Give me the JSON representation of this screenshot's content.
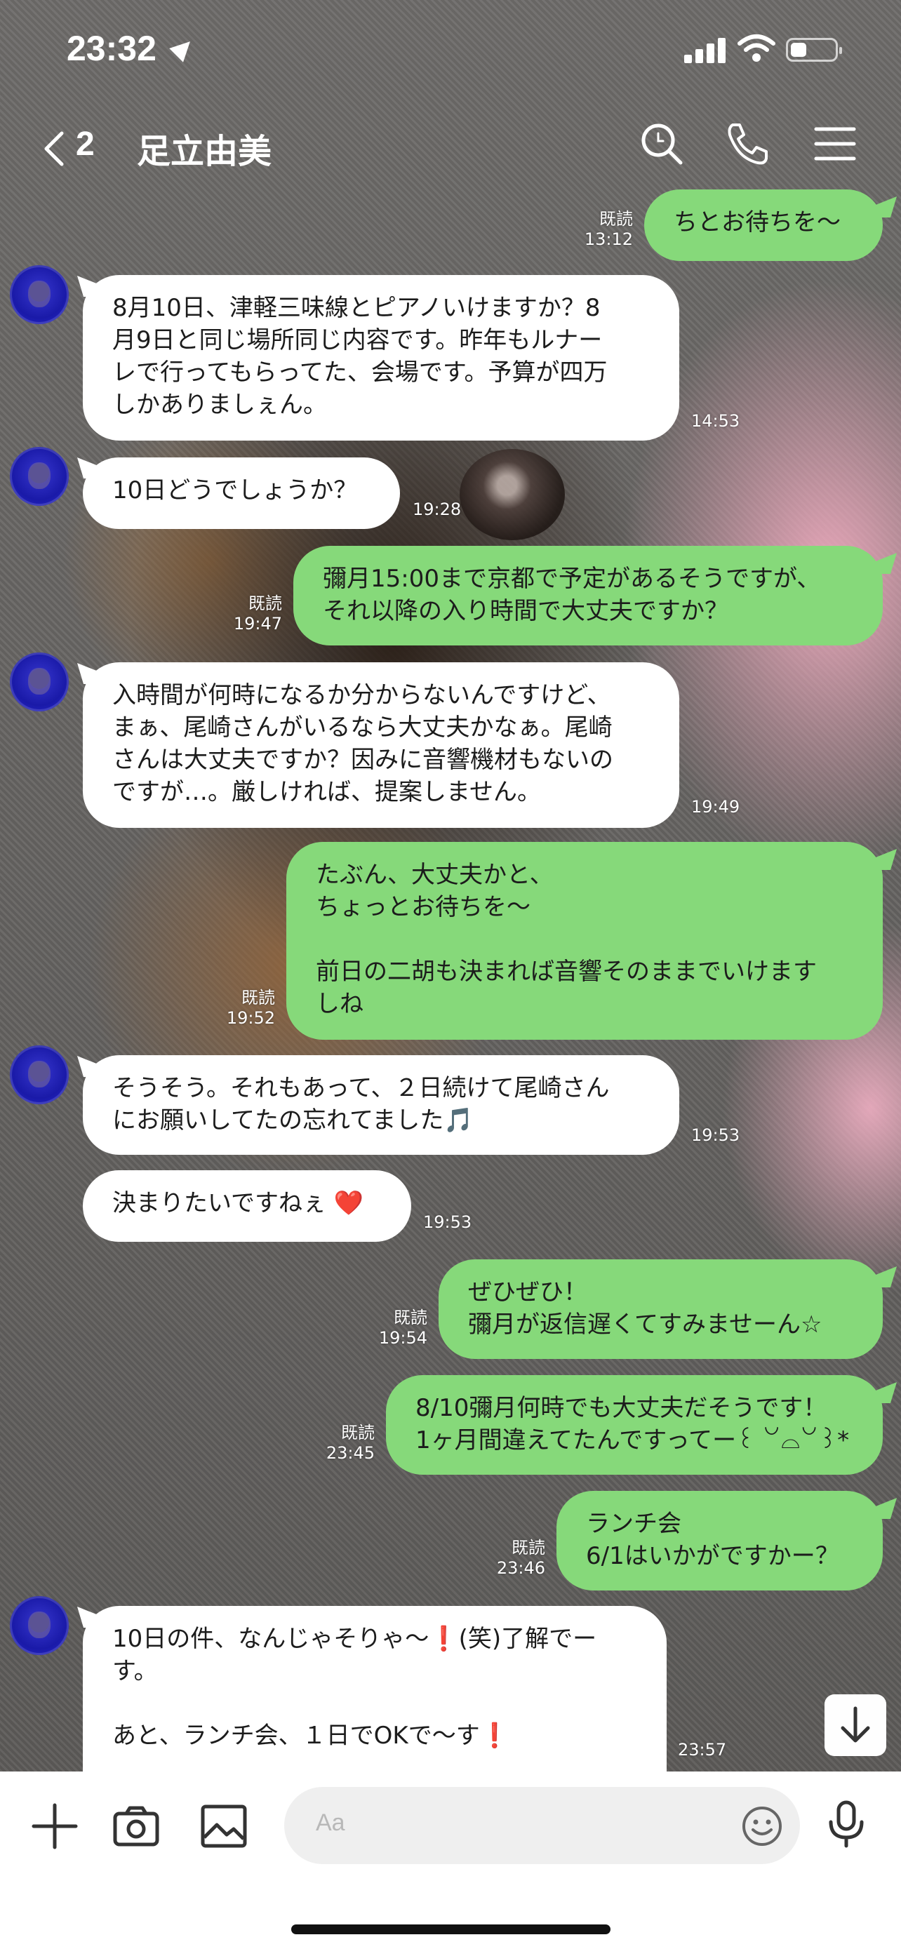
{
  "status_bar": {
    "time": "23:32"
  },
  "header": {
    "back_count": "2",
    "contact_name": "足立由美"
  },
  "messages": [
    {
      "dir": "out",
      "text": "ちとお待ちを〜",
      "read": "既読",
      "time": "13:12"
    },
    {
      "dir": "in",
      "text": "8月10日、津軽三味線とピアノいけますか？8\n月9日と同じ場所同じ内容です。昨年もルナー\nレで行ってもらってた、会場です。予算が四万\nしかありましぇん。",
      "time": "14:53"
    },
    {
      "dir": "in",
      "text": "10日どうでしょうか？",
      "time": "19:28"
    },
    {
      "dir": "out",
      "text": "彌月15:00まで京都で予定があるそうですが、\nそれ以降の入り時間で大丈夫ですか？",
      "read": "既読",
      "time": "19:47"
    },
    {
      "dir": "in",
      "text": "入時間が何時になるか分からないんですけど、\nまぁ、尾崎さんがいるなら大丈夫かなぁ。尾崎\nさんは大丈夫ですか？因みに音響機材もないの\nですが…。厳しければ、提案しません。",
      "time": "19:49"
    },
    {
      "dir": "out",
      "text": "たぶん、大丈夫かと、\nちょっとお待ちを〜\n\n前日の二胡も決まれば音響そのままでいけます\nしね",
      "read": "既読",
      "time": "19:52"
    },
    {
      "dir": "in",
      "text": "そうそう。それもあって、２日続けて尾崎さん\nにお願いしてたの忘れてました🎵",
      "time": "19:53"
    },
    {
      "dir": "in",
      "text": "決まりたいですねぇ ❤️",
      "time": "19:53"
    },
    {
      "dir": "out",
      "text": "ぜひぜひ！\n彌月が返信遅くてすみませーん☆",
      "read": "既読",
      "time": "19:54"
    },
    {
      "dir": "out",
      "text": "8/10彌月何時でも大丈夫だそうです！\n1ヶ月間違えてたんですってー꒰ ꒡⌓꒡꒱*",
      "read": "既読",
      "time": "23:45"
    },
    {
      "dir": "out",
      "text": "ランチ会\n6/1はいかがですかー？",
      "read": "既読",
      "time": "23:46"
    },
    {
      "dir": "in",
      "text": "10日の件、なんじゃそりゃ〜❗️(笑)了解でー\nす。\n\nあと、ランチ会、１日でOKで〜す❗️",
      "time": "23:57"
    }
  ],
  "input": {
    "placeholder": "Aa"
  },
  "icons": [
    "location-arrow-icon",
    "signal-icon",
    "wifi-icon",
    "battery-icon",
    "back-chevron-icon",
    "search-icon",
    "phone-icon",
    "menu-icon",
    "scroll-down-icon",
    "plus-icon",
    "camera-icon",
    "image-icon",
    "emoji-icon",
    "microphone-icon"
  ],
  "colors": {
    "outgoing_bubble": "#86d97a",
    "incoming_bubble": "#ffffff"
  }
}
